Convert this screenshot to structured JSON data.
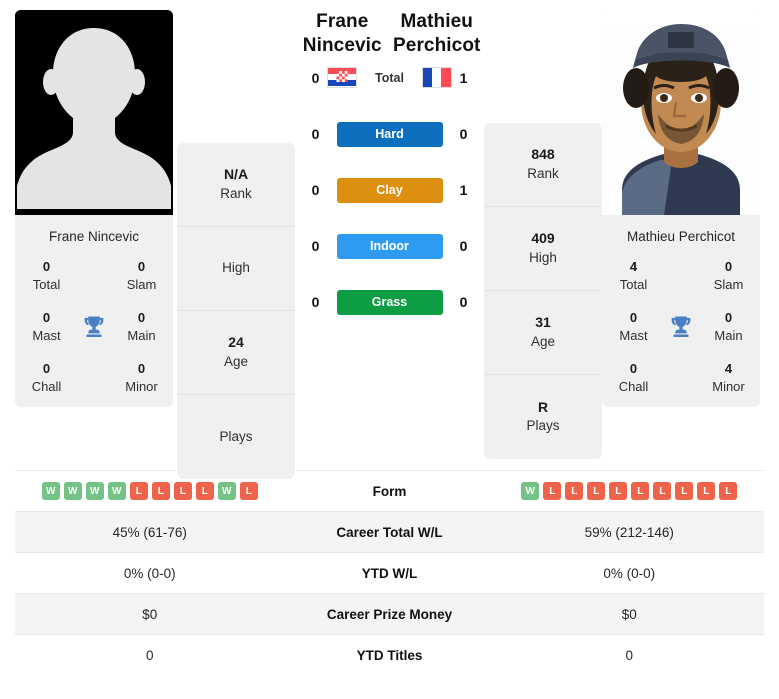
{
  "players": {
    "left": {
      "name_line1": "Frane",
      "name_line2": "Nincevic",
      "full_name": "Frane Nincevic",
      "country": "Croatia",
      "flag_icon": "croatia-flag-icon",
      "photo_type": "placeholder-avatar",
      "stats": [
        {
          "value": "N/A",
          "label": "Rank"
        },
        {
          "value": "",
          "label": "High"
        },
        {
          "value": "24",
          "label": "Age"
        },
        {
          "value": "",
          "label": "Plays"
        }
      ],
      "titles": {
        "total": "0",
        "slam": "0",
        "mast": "0",
        "main": "0",
        "chall": "0",
        "minor": "0",
        "total_label": "Total",
        "slam_label": "Slam",
        "mast_label": "Mast",
        "main_label": "Main",
        "chall_label": "Chall",
        "minor_label": "Minor"
      },
      "form": [
        "W",
        "W",
        "W",
        "W",
        "L",
        "L",
        "L",
        "L",
        "W",
        "L"
      ]
    },
    "right": {
      "name_line1": "Mathieu",
      "name_line2": "Perchicot",
      "full_name": "Mathieu Perchicot",
      "country": "France",
      "flag_icon": "france-flag-icon",
      "photo_type": "player-photo",
      "stats": [
        {
          "value": "848",
          "label": "Rank"
        },
        {
          "value": "409",
          "label": "High"
        },
        {
          "value": "31",
          "label": "Age"
        },
        {
          "value": "R",
          "label": "Plays"
        }
      ],
      "titles": {
        "total": "4",
        "slam": "0",
        "mast": "0",
        "main": "0",
        "chall": "0",
        "minor": "4",
        "total_label": "Total",
        "slam_label": "Slam",
        "mast_label": "Mast",
        "main_label": "Main",
        "chall_label": "Chall",
        "minor_label": "Minor"
      },
      "form": [
        "W",
        "L",
        "L",
        "L",
        "L",
        "L",
        "L",
        "L",
        "L",
        "L"
      ]
    }
  },
  "head_to_head": {
    "rows": [
      {
        "label": "Total",
        "left": "0",
        "right": "1",
        "color": "",
        "style": "plain"
      },
      {
        "label": "Hard",
        "left": "0",
        "right": "0",
        "color": "#0d6fbd",
        "style": "badge"
      },
      {
        "label": "Clay",
        "left": "0",
        "right": "1",
        "color": "#dd9010",
        "style": "badge"
      },
      {
        "label": "Indoor",
        "left": "0",
        "right": "0",
        "color": "#2f9bf0",
        "style": "badge"
      },
      {
        "label": "Grass",
        "left": "0",
        "right": "0",
        "color": "#0d9d42",
        "style": "badge"
      }
    ]
  },
  "comparison_table": {
    "rows": [
      {
        "label": "Form",
        "type": "form",
        "left": "",
        "right": ""
      },
      {
        "label": "Career Total W/L",
        "type": "text",
        "left": "45% (61-76)",
        "right": "59% (212-146)"
      },
      {
        "label": "YTD W/L",
        "type": "text",
        "left": "0% (0-0)",
        "right": "0% (0-0)"
      },
      {
        "label": "Career Prize Money",
        "type": "text",
        "left": "$0",
        "right": "$0"
      },
      {
        "label": "YTD Titles",
        "type": "text",
        "left": "0",
        "right": "0"
      }
    ]
  },
  "colors": {
    "hard": "#0d6fbd",
    "clay": "#dd9010",
    "indoor": "#2f9bf0",
    "grass": "#0d9d42",
    "win_badge": "#74c286",
    "loss_badge": "#f0634b",
    "card_bg": "#f0f0f0"
  }
}
